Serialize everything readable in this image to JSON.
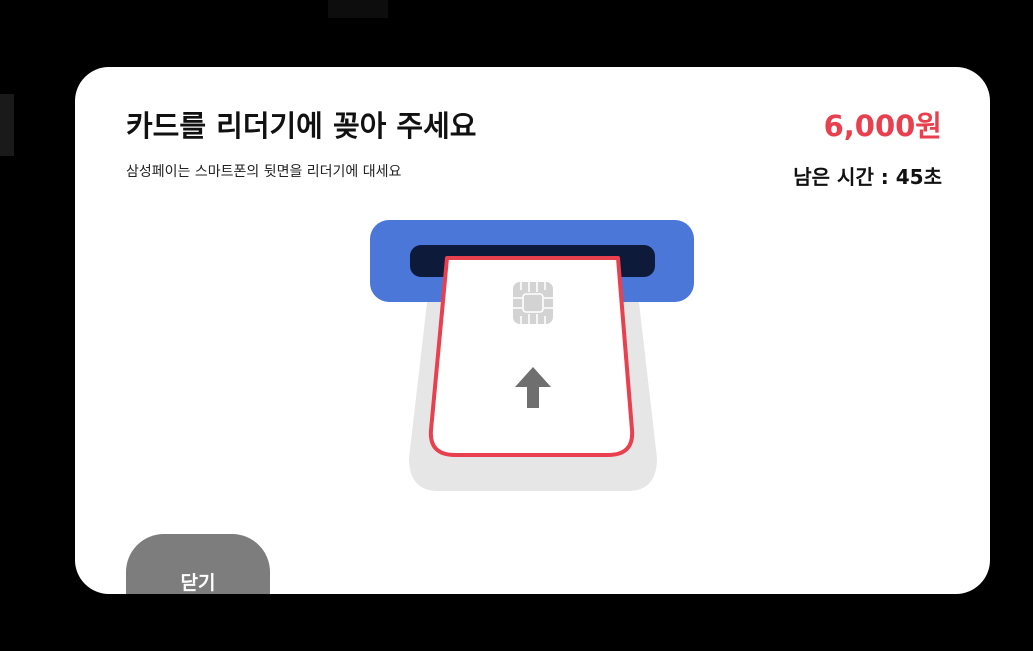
{
  "payment_dialog": {
    "title": "카드를 리더기에 꽂아 주세요",
    "subtitle": "삼성페이는 스마트폰의 뒷면을 리더기에 대세요",
    "price": "6,000원",
    "timer": "남은 시간 : 45초",
    "close_label": "닫기"
  },
  "colors": {
    "accent_red": "#e8404f",
    "reader_blue": "#4a77d8",
    "slot_navy": "#0e1a3a",
    "close_gray": "#7d7d7d"
  },
  "icons": {
    "card_chip": "card-chip-icon",
    "arrow_up": "arrow-up-icon"
  }
}
